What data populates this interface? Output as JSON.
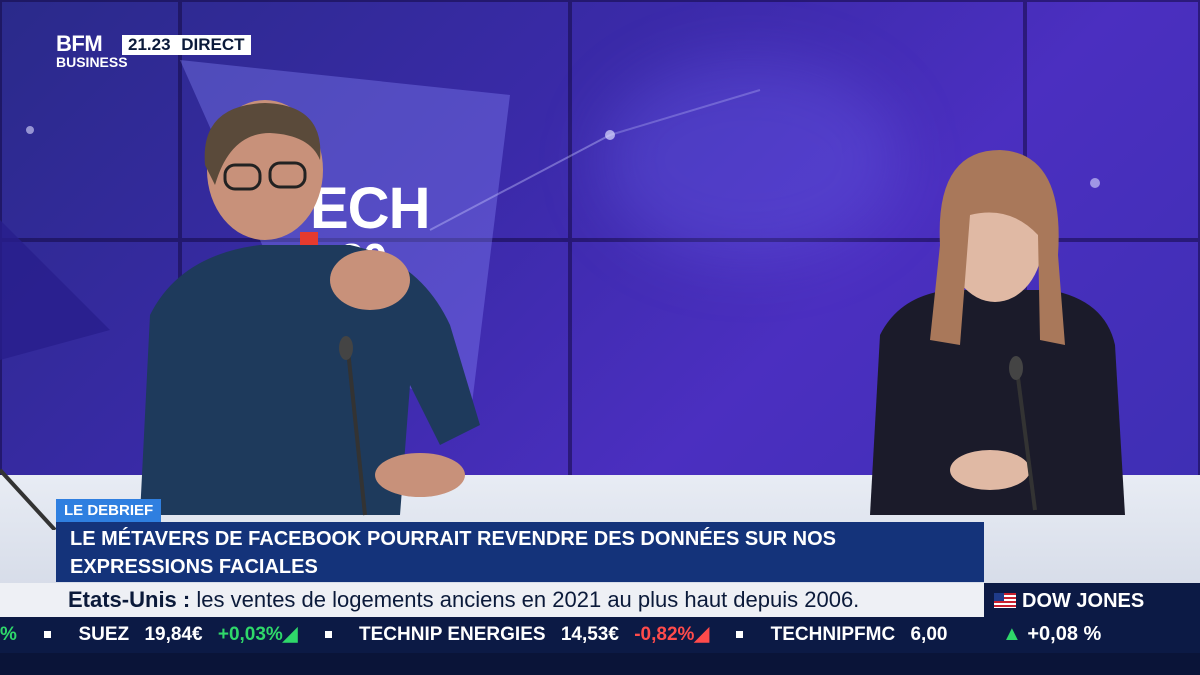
{
  "channel": {
    "logo": "BFM",
    "sub": "BUSINESS",
    "time": "21.23",
    "live": "DIRECT"
  },
  "set": {
    "logo_text": "ECH",
    "logo_sub": ".20"
  },
  "lower_third": {
    "tag": "LE DEBRIEF",
    "headline": "LE MÉTAVERS DE FACEBOOK POURRAIT REVENDRE DES DONNÉES SUR NOS EXPRESSIONS FACIALES"
  },
  "ticker": {
    "label": "Etats-Unis :",
    "text": "les ventes de logements anciens en 2021 au plus haut depuis 2006."
  },
  "market": {
    "items": [
      {
        "name": "",
        "value": "",
        "change": "%"
      },
      {
        "name": "SUEZ",
        "value": "19,84€",
        "change": "+0,03%"
      },
      {
        "name": "TECHNIP ENERGIES",
        "value": "14,53€",
        "change": "-0,82%"
      },
      {
        "name": "TECHNIPFMC",
        "value": "6,00",
        "change": ""
      }
    ],
    "index_name": "DOW JONES",
    "index_change": "+0,08 %"
  },
  "colors": {
    "headline_bg": "#14337a",
    "tag_bg": "#2f7fe0",
    "up": "#2fd86a",
    "down": "#ff4b4b"
  }
}
